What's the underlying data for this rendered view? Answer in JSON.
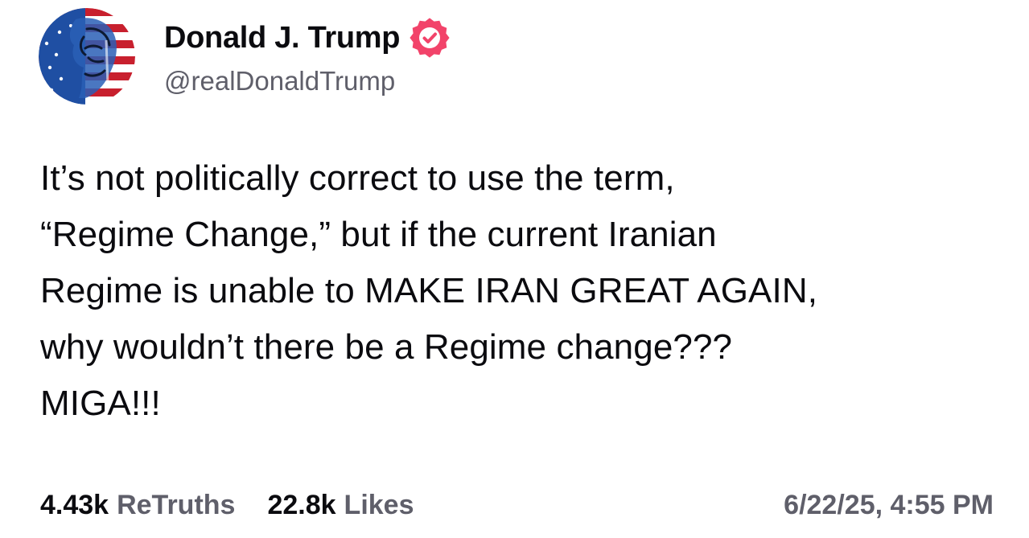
{
  "author": {
    "display_name": "Donald J. Trump",
    "handle": "@realDonaldTrump",
    "avatar_icon": "flag-portrait-avatar",
    "verified_icon": "verified-badge-icon"
  },
  "post": {
    "lines": [
      "It’s not politically correct to use the term,",
      "“Regime Change,” but if the current Iranian",
      "Regime is unable to MAKE IRAN GREAT AGAIN,",
      "why wouldn’t there be a Regime change???",
      "MIGA!!!"
    ]
  },
  "stats": {
    "retruths_count": "4.43k",
    "retruths_label": "ReTruths",
    "likes_count": "22.8k",
    "likes_label": "Likes",
    "timestamp": "6/22/25, 4:55 PM"
  },
  "colors": {
    "text_primary": "#0b0b0f",
    "text_secondary": "#5f5f6a",
    "verified_badge": "#f2436a",
    "flag_red": "#c8202e",
    "flag_blue": "#1f4fa3"
  }
}
